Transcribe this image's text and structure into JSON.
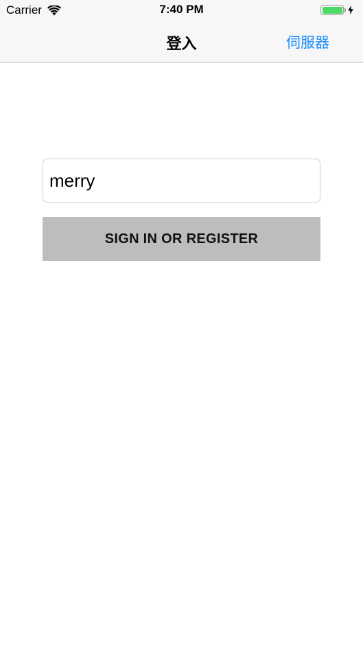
{
  "status_bar": {
    "carrier": "Carrier",
    "time": "7:40 PM",
    "battery_level": 1.0,
    "icons": [
      "wifi-icon",
      "battery-icon",
      "charging-bolt-icon"
    ]
  },
  "nav": {
    "title": "登入",
    "right_button": "伺服器"
  },
  "form": {
    "username_value": "merry",
    "submit_label": "SIGN IN OR REGISTER"
  },
  "colors": {
    "accent": "#1a8cff",
    "battery": "#4cd964",
    "button_bg": "#bdbdbd",
    "bar_bg": "#f7f7f7"
  }
}
